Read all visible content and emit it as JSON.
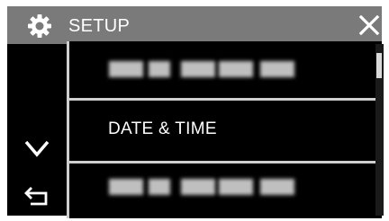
{
  "header": {
    "title": "SETUP",
    "icon": "gear-icon",
    "close_icon": "close-icon"
  },
  "nav": {
    "down_icon": "chevron-down-icon",
    "back_icon": "back-arrow-icon"
  },
  "menu": {
    "items": [
      {
        "label": ""
      },
      {
        "label": "DATE & TIME"
      },
      {
        "label": ""
      }
    ]
  },
  "colors": {
    "header_bg": "#7a7a7a",
    "body_bg": "#000000",
    "divider": "#cfcfcf",
    "text": "#ffffff"
  }
}
